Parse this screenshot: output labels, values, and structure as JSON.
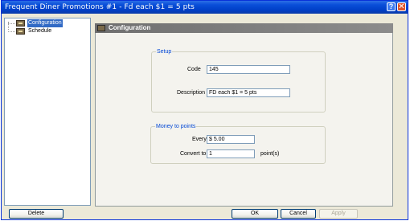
{
  "window": {
    "title": "Frequent Diner Promotions #1 - Fd each $1 = 5 pts"
  },
  "titlebar": {
    "help_label": "?",
    "close_label": "✕"
  },
  "tree": {
    "items": [
      {
        "label": "Configuration",
        "selected": true
      },
      {
        "label": "Schedule",
        "selected": false
      }
    ]
  },
  "panel": {
    "title": "Configuration"
  },
  "setup": {
    "title": "Setup",
    "code_label": "Code",
    "code_value": "145",
    "description_label": "Description",
    "description_value": "FD each $1 = 5 pts"
  },
  "money": {
    "title": "Money to points",
    "every_label": "Every",
    "every_value": "$ 5.00",
    "convert_label": "Convert to",
    "convert_value": "1",
    "points_suffix": "point(s)"
  },
  "buttons": {
    "delete": "Delete",
    "ok": "OK",
    "cancel": "Cancel",
    "apply": "Apply"
  }
}
